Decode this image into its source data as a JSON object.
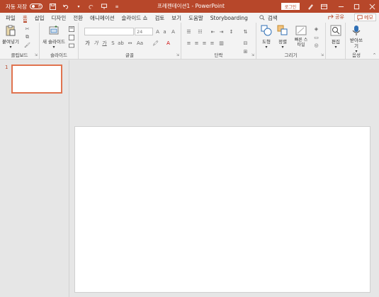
{
  "titlebar": {
    "autosave_label": "자동 저장",
    "autosave_state": "끔",
    "document_title": "프레젠테이션1 - PowerPoint",
    "login_label": "로그인"
  },
  "tabs": [
    "파일",
    "홈",
    "삽입",
    "디자인",
    "전환",
    "애니메이션",
    "슬라이드 쇼",
    "검토",
    "보기",
    "도움말",
    "Storyboarding",
    "검색"
  ],
  "active_tab": "홈",
  "share_label": "공유",
  "memo_label": "메모",
  "ribbon": {
    "clipboard": {
      "paste_label": "붙여넣기",
      "group_label": "클립보드"
    },
    "slides": {
      "new_slide_label": "새 슬라이드",
      "group_label": "슬라이드"
    },
    "font": {
      "font_size": "24",
      "group_label": "글꼴"
    },
    "paragraph": {
      "group_label": "단락"
    },
    "drawing": {
      "shapes_label": "도형",
      "arrange_label": "정렬",
      "quick_styles_label": "빠른 스타일",
      "group_label": "그리기"
    },
    "editing": {
      "edit_label": "편집"
    },
    "voice": {
      "dictate_label": "받아쓰기",
      "group_label": "음성"
    }
  },
  "slides_pane": {
    "slide_number": "1"
  },
  "colors": {
    "accent": "#b7472a",
    "selection": "#e0734f"
  }
}
